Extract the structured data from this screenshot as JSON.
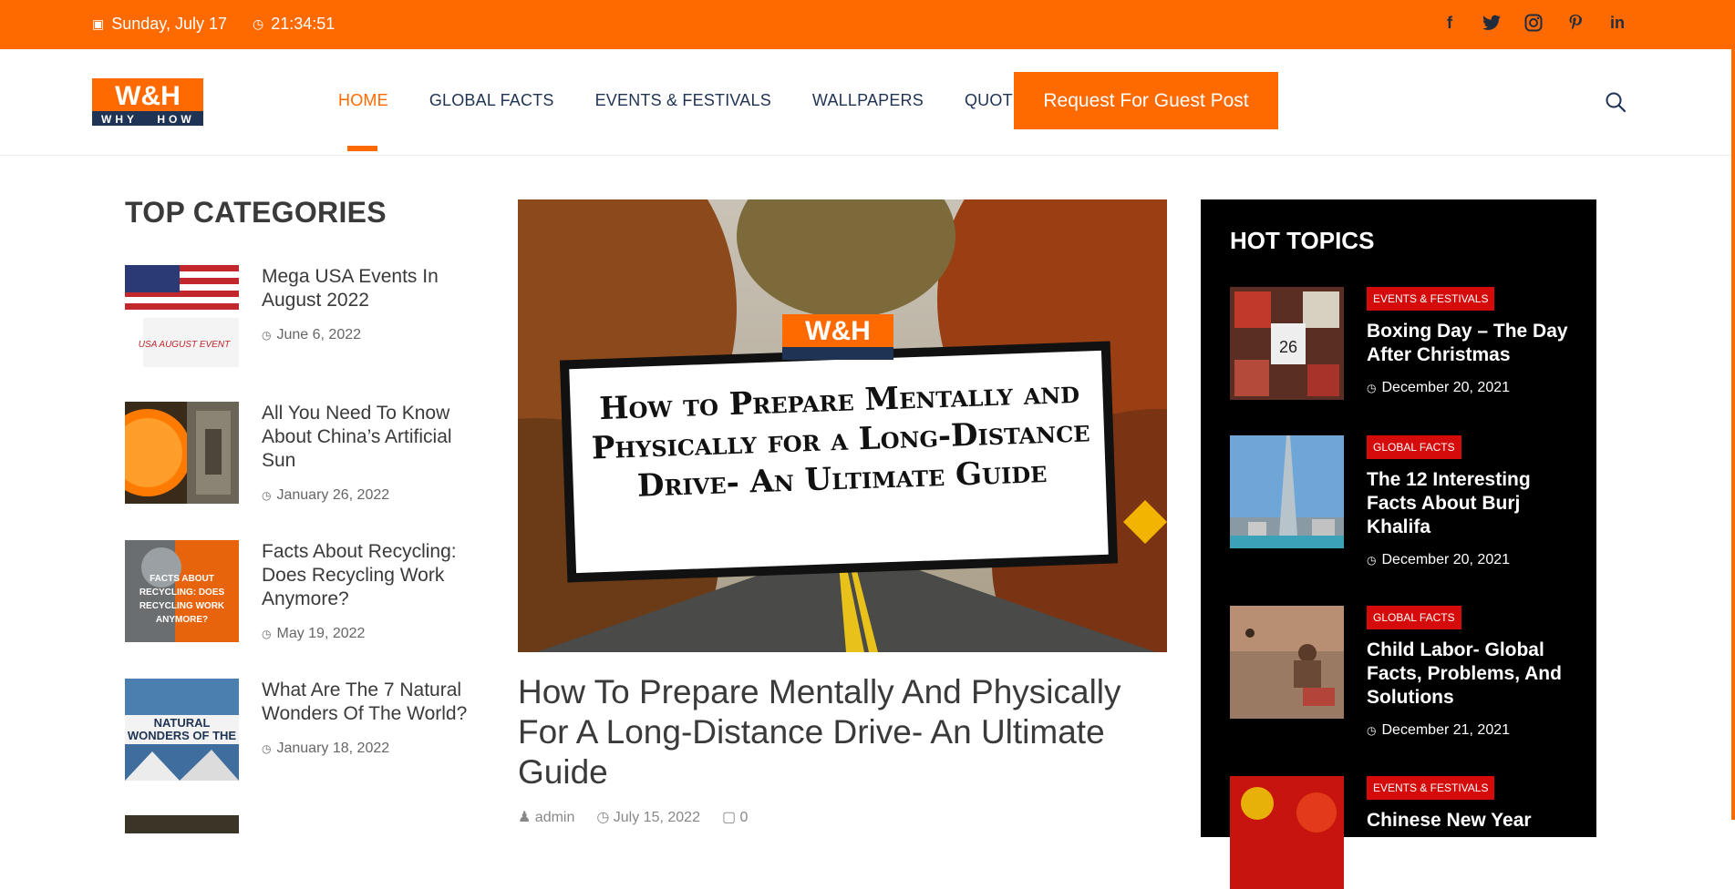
{
  "topbar": {
    "date": "Sunday, July 17",
    "time": "21:34:51",
    "social": [
      "facebook-icon",
      "twitter-icon",
      "instagram-icon",
      "pinterest-icon",
      "linkedin-icon"
    ]
  },
  "logo": {
    "main": "W&H",
    "sub_left": "WHY",
    "sub_right": "HOW"
  },
  "nav": {
    "items": [
      "HOME",
      "GLOBAL FACTS",
      "EVENTS & FESTIVALS",
      "WALLPAPERS",
      "QUOTES"
    ],
    "cta": "Request For Guest Post"
  },
  "top_categories": {
    "title": "TOP CATEGORIES",
    "items": [
      {
        "title": "Mega USA Events In August 2022",
        "date": "June 6, 2022",
        "thumb_text": "USA AUGUST EVENT"
      },
      {
        "title": "All You Need To Know About China’s Artificial Sun",
        "date": "January 26, 2022"
      },
      {
        "title": "Facts About Recycling: Does Recycling Work Anymore?",
        "date": "May 19, 2022",
        "thumb_text": "FACTS ABOUT RECYCLING: DOES RECYCLING WORK ANYMORE?"
      },
      {
        "title": "What Are The 7 Natural Wonders Of The World?",
        "date": "January 18, 2022",
        "thumb_text": "NATURAL WONDERS OF THE WORLD"
      }
    ]
  },
  "feature": {
    "image_text": "How to Prepare Mentally and Physically for a Long-Distance Drive- An Ultimate Guide",
    "title": "How To Prepare Mentally And Physically For A Long-Distance Drive- An Ultimate Guide",
    "author": "admin",
    "date": "July 15, 2022",
    "comments": "0"
  },
  "hot_topics": {
    "title": "HOT TOPICS",
    "items": [
      {
        "badge": "EVENTS & FESTIVALS",
        "title": "Boxing Day – The Day After Christmas",
        "date": "December 20, 2021"
      },
      {
        "badge": "GLOBAL FACTS",
        "title": "The 12 Interesting Facts About Burj Khalifa",
        "date": "December 20, 2021"
      },
      {
        "badge": "GLOBAL FACTS",
        "title": "Child Labor- Global Facts, Problems, And Solutions",
        "date": "December 21, 2021"
      },
      {
        "badge": "EVENTS & FESTIVALS",
        "title": "Chinese New Year",
        "date": ""
      }
    ]
  },
  "colors": {
    "accent": "#ff6a00",
    "navy": "#1f3354",
    "badge": "#d50a0a"
  }
}
